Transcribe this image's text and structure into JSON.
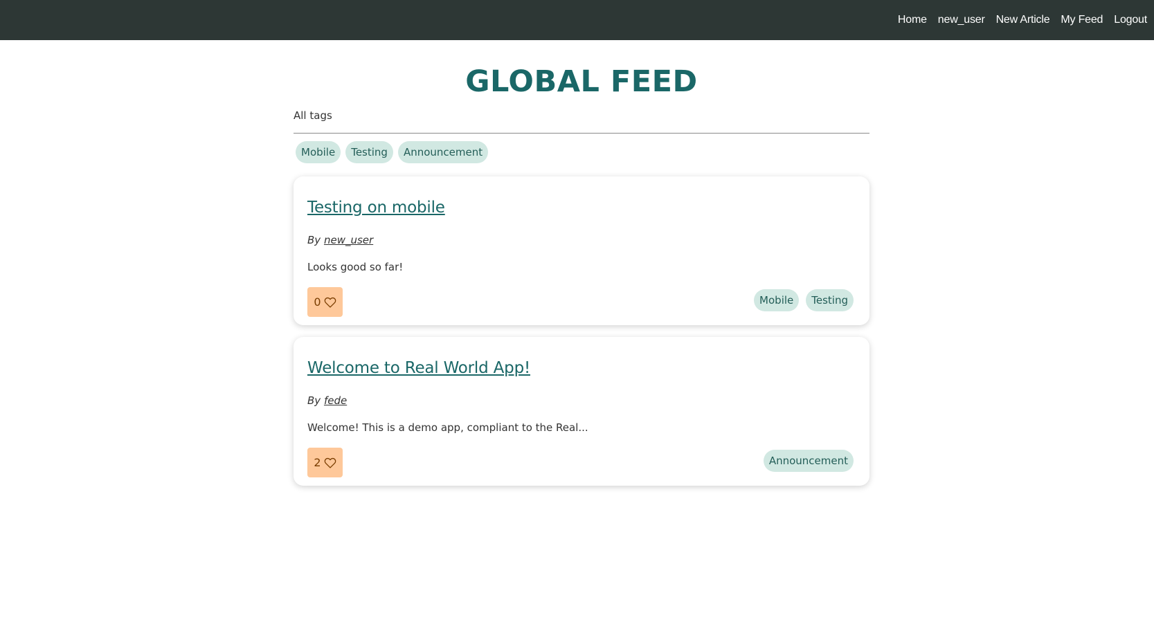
{
  "nav": {
    "links": [
      "Home",
      "new_user",
      "New Article",
      "My Feed",
      "Logout"
    ]
  },
  "page": {
    "title": "GLOBAL FEED"
  },
  "tags": {
    "header": "All tags",
    "items": [
      "Mobile",
      "Testing",
      "Announcement"
    ]
  },
  "articles": [
    {
      "title": "Testing on mobile",
      "by_prefix": "By",
      "author": "new_user",
      "excerpt": "Looks good so far!",
      "likes": "0",
      "tags": [
        "Mobile",
        "Testing"
      ]
    },
    {
      "title": "Welcome to Real World App!",
      "by_prefix": "By",
      "author": "fede",
      "excerpt": "Welcome! This is a demo app, compliant to the Real...",
      "likes": "2",
      "tags": [
        "Announcement"
      ]
    }
  ],
  "colors": {
    "navbar": "#2d3735",
    "accent": "#1a6767",
    "tag_bg": "#d1e8e2",
    "like_bg": "#fec89a"
  },
  "icons": {
    "like": "heart-icon"
  }
}
